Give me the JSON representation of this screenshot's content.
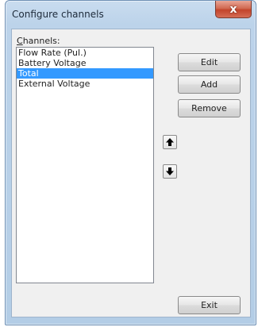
{
  "window": {
    "title": "Configure channels",
    "close_label": "x"
  },
  "channels": {
    "label_mnemonic": "C",
    "label_rest": "hannels:",
    "items": [
      {
        "label": "Flow Rate (Pul.)",
        "selected": false
      },
      {
        "label": "Battery Voltage",
        "selected": false
      },
      {
        "label": "Total",
        "selected": true
      },
      {
        "label": "External Voltage",
        "selected": false
      }
    ]
  },
  "buttons": {
    "edit": "Edit",
    "add": "Add",
    "remove": "Remove",
    "exit": "Exit"
  },
  "icons": {
    "move_up": "arrow-up-icon",
    "move_down": "arrow-down-icon"
  },
  "colors": {
    "selection": "#3399ff",
    "close_button": "#c3442b"
  }
}
